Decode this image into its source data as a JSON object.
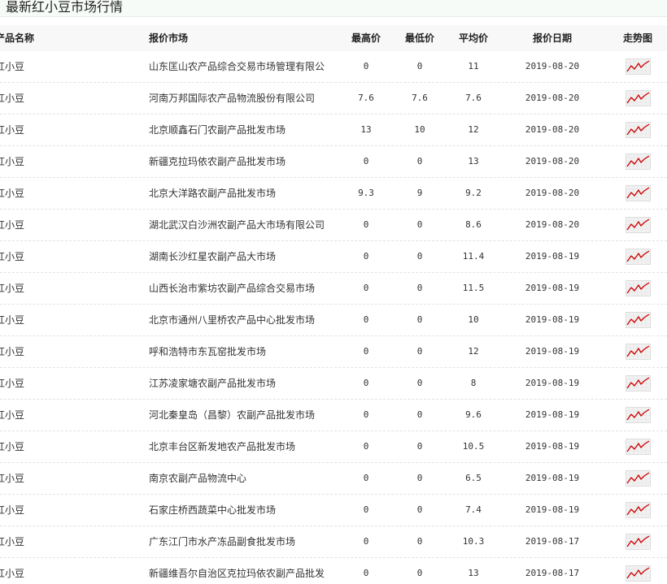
{
  "header": {
    "title": "最新红小豆市场行情"
  },
  "table": {
    "columns": {
      "product": "产品名称",
      "market": "报价市场",
      "high": "最高价",
      "low": "最低价",
      "avg": "平均价",
      "date": "报价日期",
      "trend": "走势图"
    },
    "trend_icon": "trend-chart-icon",
    "trend_color": "#cc0000",
    "rows": [
      {
        "product": "红小豆",
        "market": "山东匡山农产品综合交易市场管理有限公",
        "high": "0",
        "low": "0",
        "avg": "11",
        "date": "2019-08-20"
      },
      {
        "product": "红小豆",
        "market": "河南万邦国际农产品物流股份有限公司",
        "high": "7.6",
        "low": "7.6",
        "avg": "7.6",
        "date": "2019-08-20"
      },
      {
        "product": "红小豆",
        "market": "北京顺鑫石门农副产品批发市场",
        "high": "13",
        "low": "10",
        "avg": "12",
        "date": "2019-08-20"
      },
      {
        "product": "红小豆",
        "market": "新疆克拉玛依农副产品批发市场",
        "high": "0",
        "low": "0",
        "avg": "13",
        "date": "2019-08-20"
      },
      {
        "product": "红小豆",
        "market": "北京大洋路农副产品批发市场",
        "high": "9.3",
        "low": "9",
        "avg": "9.2",
        "date": "2019-08-20"
      },
      {
        "product": "红小豆",
        "market": "湖北武汉白沙洲农副产品大市场有限公司",
        "high": "0",
        "low": "0",
        "avg": "8.6",
        "date": "2019-08-20"
      },
      {
        "product": "红小豆",
        "market": "湖南长沙红星农副产品大市场",
        "high": "0",
        "low": "0",
        "avg": "11.4",
        "date": "2019-08-19"
      },
      {
        "product": "红小豆",
        "market": "山西长治市紫坊农副产品综合交易市场",
        "high": "0",
        "low": "0",
        "avg": "11.5",
        "date": "2019-08-19"
      },
      {
        "product": "红小豆",
        "market": "北京市通州八里桥农产品中心批发市场",
        "high": "0",
        "low": "0",
        "avg": "10",
        "date": "2019-08-19"
      },
      {
        "product": "红小豆",
        "market": "呼和浩特市东瓦窑批发市场",
        "high": "0",
        "low": "0",
        "avg": "12",
        "date": "2019-08-19"
      },
      {
        "product": "红小豆",
        "market": "江苏凌家塘农副产品批发市场",
        "high": "0",
        "low": "0",
        "avg": "8",
        "date": "2019-08-19"
      },
      {
        "product": "红小豆",
        "market": "河北秦皇岛（昌黎）农副产品批发市场",
        "high": "0",
        "low": "0",
        "avg": "9.6",
        "date": "2019-08-19"
      },
      {
        "product": "红小豆",
        "market": "北京丰台区新发地农产品批发市场",
        "high": "0",
        "low": "0",
        "avg": "10.5",
        "date": "2019-08-19"
      },
      {
        "product": "红小豆",
        "market": "南京农副产品物流中心",
        "high": "0",
        "low": "0",
        "avg": "6.5",
        "date": "2019-08-19"
      },
      {
        "product": "红小豆",
        "market": "石家庄桥西蔬菜中心批发市场",
        "high": "0",
        "low": "0",
        "avg": "7.4",
        "date": "2019-08-19"
      },
      {
        "product": "红小豆",
        "market": "广东江门市水产冻品副食批发市场",
        "high": "0",
        "low": "0",
        "avg": "10.3",
        "date": "2019-08-17"
      },
      {
        "product": "红小豆",
        "market": "新疆维吾尔自治区克拉玛依农副产品批发",
        "high": "0",
        "low": "0",
        "avg": "13",
        "date": "2019-08-17"
      }
    ]
  }
}
